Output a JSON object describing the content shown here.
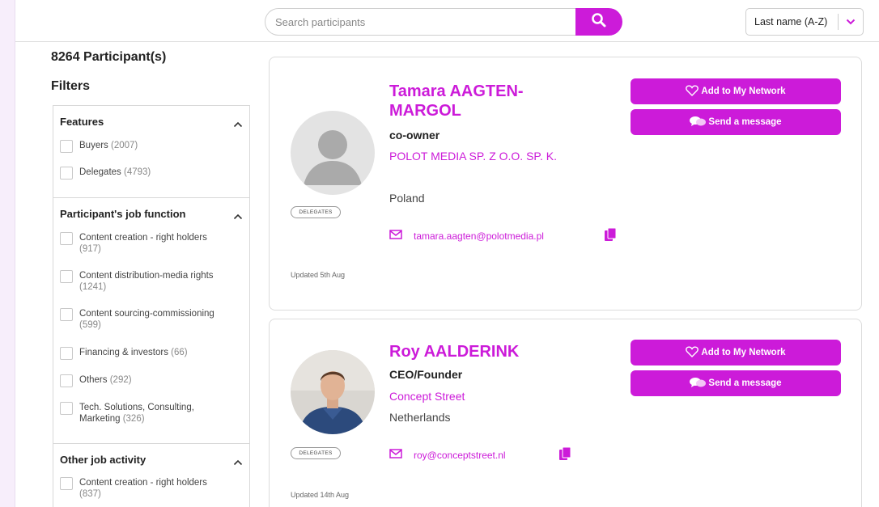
{
  "header": {
    "search_placeholder": "Search participants",
    "sort_label": "Last name (A-Z)"
  },
  "sidebar": {
    "count": "8264 Participant(s)",
    "filters_title": "Filters",
    "groups": [
      {
        "title": "Features",
        "options": [
          {
            "label": "Buyers",
            "count": "(2007)"
          },
          {
            "label": "Delegates",
            "count": "(4793)"
          }
        ]
      },
      {
        "title": "Participant's job function",
        "options": [
          {
            "label": "Content creation - right holders",
            "count": "(917)"
          },
          {
            "label": "Content distribution-media rights",
            "count": "(1241)"
          },
          {
            "label": "Content sourcing-commissioning",
            "count": "(599)"
          },
          {
            "label": "Financing & investors",
            "count": "(66)"
          },
          {
            "label": "Others",
            "count": "(292)"
          },
          {
            "label": "Tech. Solutions, Consulting, Marketing",
            "count": "(326)"
          }
        ]
      },
      {
        "title": "Other job activity",
        "options": [
          {
            "label": "Content creation - right holders",
            "count": "(837)"
          }
        ]
      }
    ]
  },
  "participants": [
    {
      "name": "Tamara AAGTEN-MARGOL",
      "job": "co-owner",
      "company": "POLOT MEDIA SP. Z O.O. SP. K.",
      "country": "Poland",
      "email": "tamara.aagten@polotmedia.pl",
      "badge": "DELEGATES",
      "updated": "Updated 5th Aug",
      "add_label": "Add to My Network",
      "message_label": "Send a message"
    },
    {
      "name": "Roy AALDERINK",
      "job": "CEO/Founder",
      "company": "Concept Street",
      "country": "Netherlands",
      "email": "roy@conceptstreet.nl",
      "badge": "DELEGATES",
      "updated": "Updated 14th Aug",
      "add_label": "Add to My Network",
      "message_label": "Send a message"
    }
  ],
  "colors": {
    "accent": "#cc1bd9",
    "page_bg": "#f7eefb"
  }
}
